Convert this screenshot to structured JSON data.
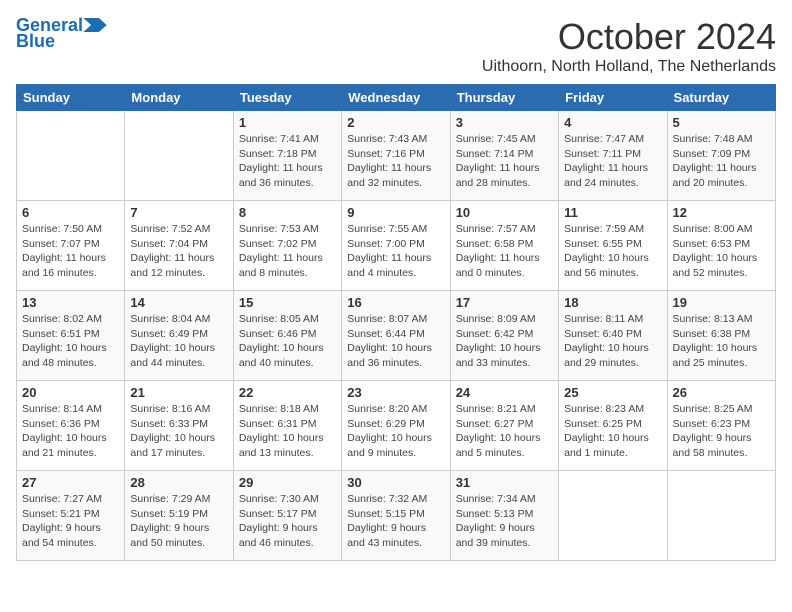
{
  "logo": {
    "line1": "General",
    "line2": "Blue"
  },
  "title": "October 2024",
  "location": "Uithoorn, North Holland, The Netherlands",
  "days_of_week": [
    "Sunday",
    "Monday",
    "Tuesday",
    "Wednesday",
    "Thursday",
    "Friday",
    "Saturday"
  ],
  "weeks": [
    [
      {
        "day": "",
        "info": ""
      },
      {
        "day": "",
        "info": ""
      },
      {
        "day": "1",
        "info": "Sunrise: 7:41 AM\nSunset: 7:18 PM\nDaylight: 11 hours\nand 36 minutes."
      },
      {
        "day": "2",
        "info": "Sunrise: 7:43 AM\nSunset: 7:16 PM\nDaylight: 11 hours\nand 32 minutes."
      },
      {
        "day": "3",
        "info": "Sunrise: 7:45 AM\nSunset: 7:14 PM\nDaylight: 11 hours\nand 28 minutes."
      },
      {
        "day": "4",
        "info": "Sunrise: 7:47 AM\nSunset: 7:11 PM\nDaylight: 11 hours\nand 24 minutes."
      },
      {
        "day": "5",
        "info": "Sunrise: 7:48 AM\nSunset: 7:09 PM\nDaylight: 11 hours\nand 20 minutes."
      }
    ],
    [
      {
        "day": "6",
        "info": "Sunrise: 7:50 AM\nSunset: 7:07 PM\nDaylight: 11 hours\nand 16 minutes."
      },
      {
        "day": "7",
        "info": "Sunrise: 7:52 AM\nSunset: 7:04 PM\nDaylight: 11 hours\nand 12 minutes."
      },
      {
        "day": "8",
        "info": "Sunrise: 7:53 AM\nSunset: 7:02 PM\nDaylight: 11 hours\nand 8 minutes."
      },
      {
        "day": "9",
        "info": "Sunrise: 7:55 AM\nSunset: 7:00 PM\nDaylight: 11 hours\nand 4 minutes."
      },
      {
        "day": "10",
        "info": "Sunrise: 7:57 AM\nSunset: 6:58 PM\nDaylight: 11 hours\nand 0 minutes."
      },
      {
        "day": "11",
        "info": "Sunrise: 7:59 AM\nSunset: 6:55 PM\nDaylight: 10 hours\nand 56 minutes."
      },
      {
        "day": "12",
        "info": "Sunrise: 8:00 AM\nSunset: 6:53 PM\nDaylight: 10 hours\nand 52 minutes."
      }
    ],
    [
      {
        "day": "13",
        "info": "Sunrise: 8:02 AM\nSunset: 6:51 PM\nDaylight: 10 hours\nand 48 minutes."
      },
      {
        "day": "14",
        "info": "Sunrise: 8:04 AM\nSunset: 6:49 PM\nDaylight: 10 hours\nand 44 minutes."
      },
      {
        "day": "15",
        "info": "Sunrise: 8:05 AM\nSunset: 6:46 PM\nDaylight: 10 hours\nand 40 minutes."
      },
      {
        "day": "16",
        "info": "Sunrise: 8:07 AM\nSunset: 6:44 PM\nDaylight: 10 hours\nand 36 minutes."
      },
      {
        "day": "17",
        "info": "Sunrise: 8:09 AM\nSunset: 6:42 PM\nDaylight: 10 hours\nand 33 minutes."
      },
      {
        "day": "18",
        "info": "Sunrise: 8:11 AM\nSunset: 6:40 PM\nDaylight: 10 hours\nand 29 minutes."
      },
      {
        "day": "19",
        "info": "Sunrise: 8:13 AM\nSunset: 6:38 PM\nDaylight: 10 hours\nand 25 minutes."
      }
    ],
    [
      {
        "day": "20",
        "info": "Sunrise: 8:14 AM\nSunset: 6:36 PM\nDaylight: 10 hours\nand 21 minutes."
      },
      {
        "day": "21",
        "info": "Sunrise: 8:16 AM\nSunset: 6:33 PM\nDaylight: 10 hours\nand 17 minutes."
      },
      {
        "day": "22",
        "info": "Sunrise: 8:18 AM\nSunset: 6:31 PM\nDaylight: 10 hours\nand 13 minutes."
      },
      {
        "day": "23",
        "info": "Sunrise: 8:20 AM\nSunset: 6:29 PM\nDaylight: 10 hours\nand 9 minutes."
      },
      {
        "day": "24",
        "info": "Sunrise: 8:21 AM\nSunset: 6:27 PM\nDaylight: 10 hours\nand 5 minutes."
      },
      {
        "day": "25",
        "info": "Sunrise: 8:23 AM\nSunset: 6:25 PM\nDaylight: 10 hours\nand 1 minute."
      },
      {
        "day": "26",
        "info": "Sunrise: 8:25 AM\nSunset: 6:23 PM\nDaylight: 9 hours\nand 58 minutes."
      }
    ],
    [
      {
        "day": "27",
        "info": "Sunrise: 7:27 AM\nSunset: 5:21 PM\nDaylight: 9 hours\nand 54 minutes."
      },
      {
        "day": "28",
        "info": "Sunrise: 7:29 AM\nSunset: 5:19 PM\nDaylight: 9 hours\nand 50 minutes."
      },
      {
        "day": "29",
        "info": "Sunrise: 7:30 AM\nSunset: 5:17 PM\nDaylight: 9 hours\nand 46 minutes."
      },
      {
        "day": "30",
        "info": "Sunrise: 7:32 AM\nSunset: 5:15 PM\nDaylight: 9 hours\nand 43 minutes."
      },
      {
        "day": "31",
        "info": "Sunrise: 7:34 AM\nSunset: 5:13 PM\nDaylight: 9 hours\nand 39 minutes."
      },
      {
        "day": "",
        "info": ""
      },
      {
        "day": "",
        "info": ""
      }
    ]
  ]
}
